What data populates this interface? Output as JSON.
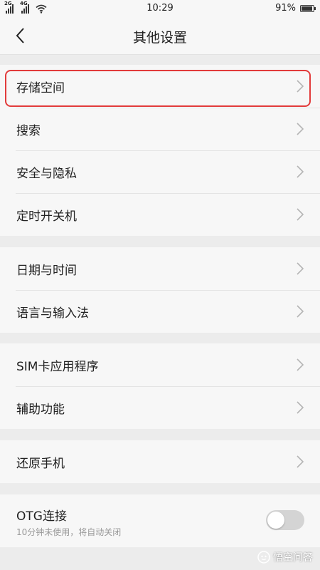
{
  "status_bar": {
    "sim1_network": "2G",
    "sim2_network": "4G",
    "time": "10:29",
    "battery_text": "91%",
    "battery_level": 0.91
  },
  "header": {
    "title": "其他设置"
  },
  "groups": [
    {
      "items": [
        {
          "label": "存储空间"
        },
        {
          "label": "搜索"
        },
        {
          "label": "安全与隐私"
        },
        {
          "label": "定时开关机"
        }
      ]
    },
    {
      "items": [
        {
          "label": "日期与时间"
        },
        {
          "label": "语言与输入法"
        }
      ]
    },
    {
      "items": [
        {
          "label": "SIM卡应用程序"
        },
        {
          "label": "辅助功能"
        }
      ]
    },
    {
      "items": [
        {
          "label": "还原手机"
        }
      ]
    }
  ],
  "otg": {
    "label": "OTG连接",
    "subtitle": "10分钟未使用，将自动关闭",
    "enabled": false
  },
  "watermark": {
    "text": "悟空问答"
  },
  "colors": {
    "highlight": "#e23b3b",
    "background": "#ececec",
    "panel": "#f7f7f7"
  }
}
